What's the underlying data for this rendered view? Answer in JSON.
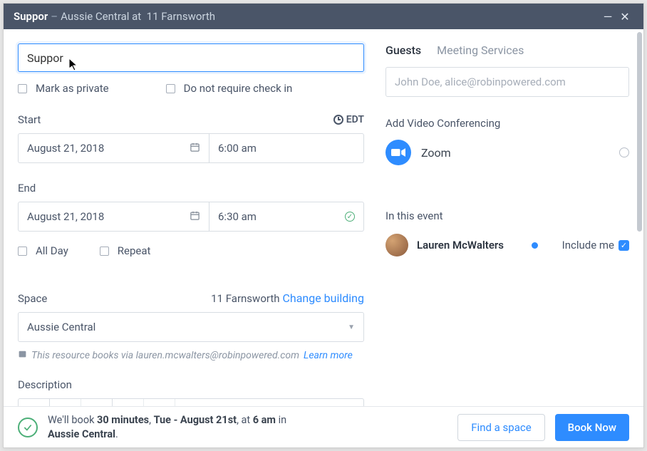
{
  "window": {
    "title": "Suppor",
    "separator": "–",
    "location_prefix": "Aussie Central at",
    "location": "11 Farnsworth"
  },
  "form": {
    "title_value": "Suppor",
    "mark_private": "Mark as private",
    "no_checkin": "Do not require check in",
    "start_label": "Start",
    "end_label": "End",
    "timezone": "EDT",
    "start_date": "August 21, 2018",
    "start_time": "6:00 am",
    "end_date": "August 21, 2018",
    "end_time": "6:30 am",
    "all_day": "All Day",
    "repeat": "Repeat",
    "space_label": "Space",
    "building": "11 Farnsworth",
    "change_building": "Change building",
    "space_value": "Aussie Central",
    "note_prefix": "This resource books via",
    "note_email": "lauren.mcwalters@robinpowered.com",
    "note_link": "Learn more",
    "description_label": "Description"
  },
  "right": {
    "tab_guests": "Guests",
    "tab_services": "Meeting Services",
    "guest_placeholder": "John Doe, alice@robinpowered.com",
    "video_label": "Add Video Conferencing",
    "zoom": "Zoom",
    "in_event": "In this event",
    "guest_name": "Lauren McWalters",
    "include_me": "Include me"
  },
  "footer": {
    "prefix": "We'll book ",
    "duration": "30 minutes",
    "sep1": ", ",
    "date": "Tue - August 21st",
    "sep2": ", at ",
    "time": "6 am",
    "suffix": " in",
    "room": "Aussie Central",
    "dot": ".",
    "find_space": "Find a space",
    "book_now": "Book Now"
  }
}
